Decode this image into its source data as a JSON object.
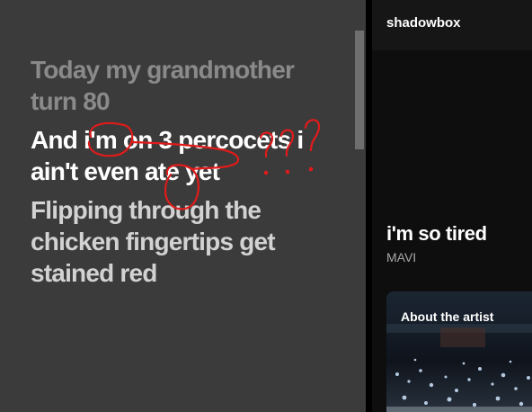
{
  "lyrics": {
    "lines": [
      {
        "text": "Today my grandmother turn 80",
        "state": "past"
      },
      {
        "text": "And i'm on 3 percocets i ain't even ate yet",
        "state": "active"
      },
      {
        "text": "Flipping through the chicken fingertips get stained red",
        "state": "upcoming"
      }
    ]
  },
  "now_playing": {
    "header_title": "shadowbox",
    "song_title": "i'm so tired",
    "artist": "MAVI",
    "about_label": "About the artist"
  },
  "annotation": {
    "text": "???",
    "color": "#e11b1b"
  },
  "colors": {
    "lyrics_background": "#3b3b3b",
    "active_lyric": "#ffffff",
    "past_lyric": "#8a8a8a",
    "upcoming_lyric": "#d2d2d2"
  }
}
